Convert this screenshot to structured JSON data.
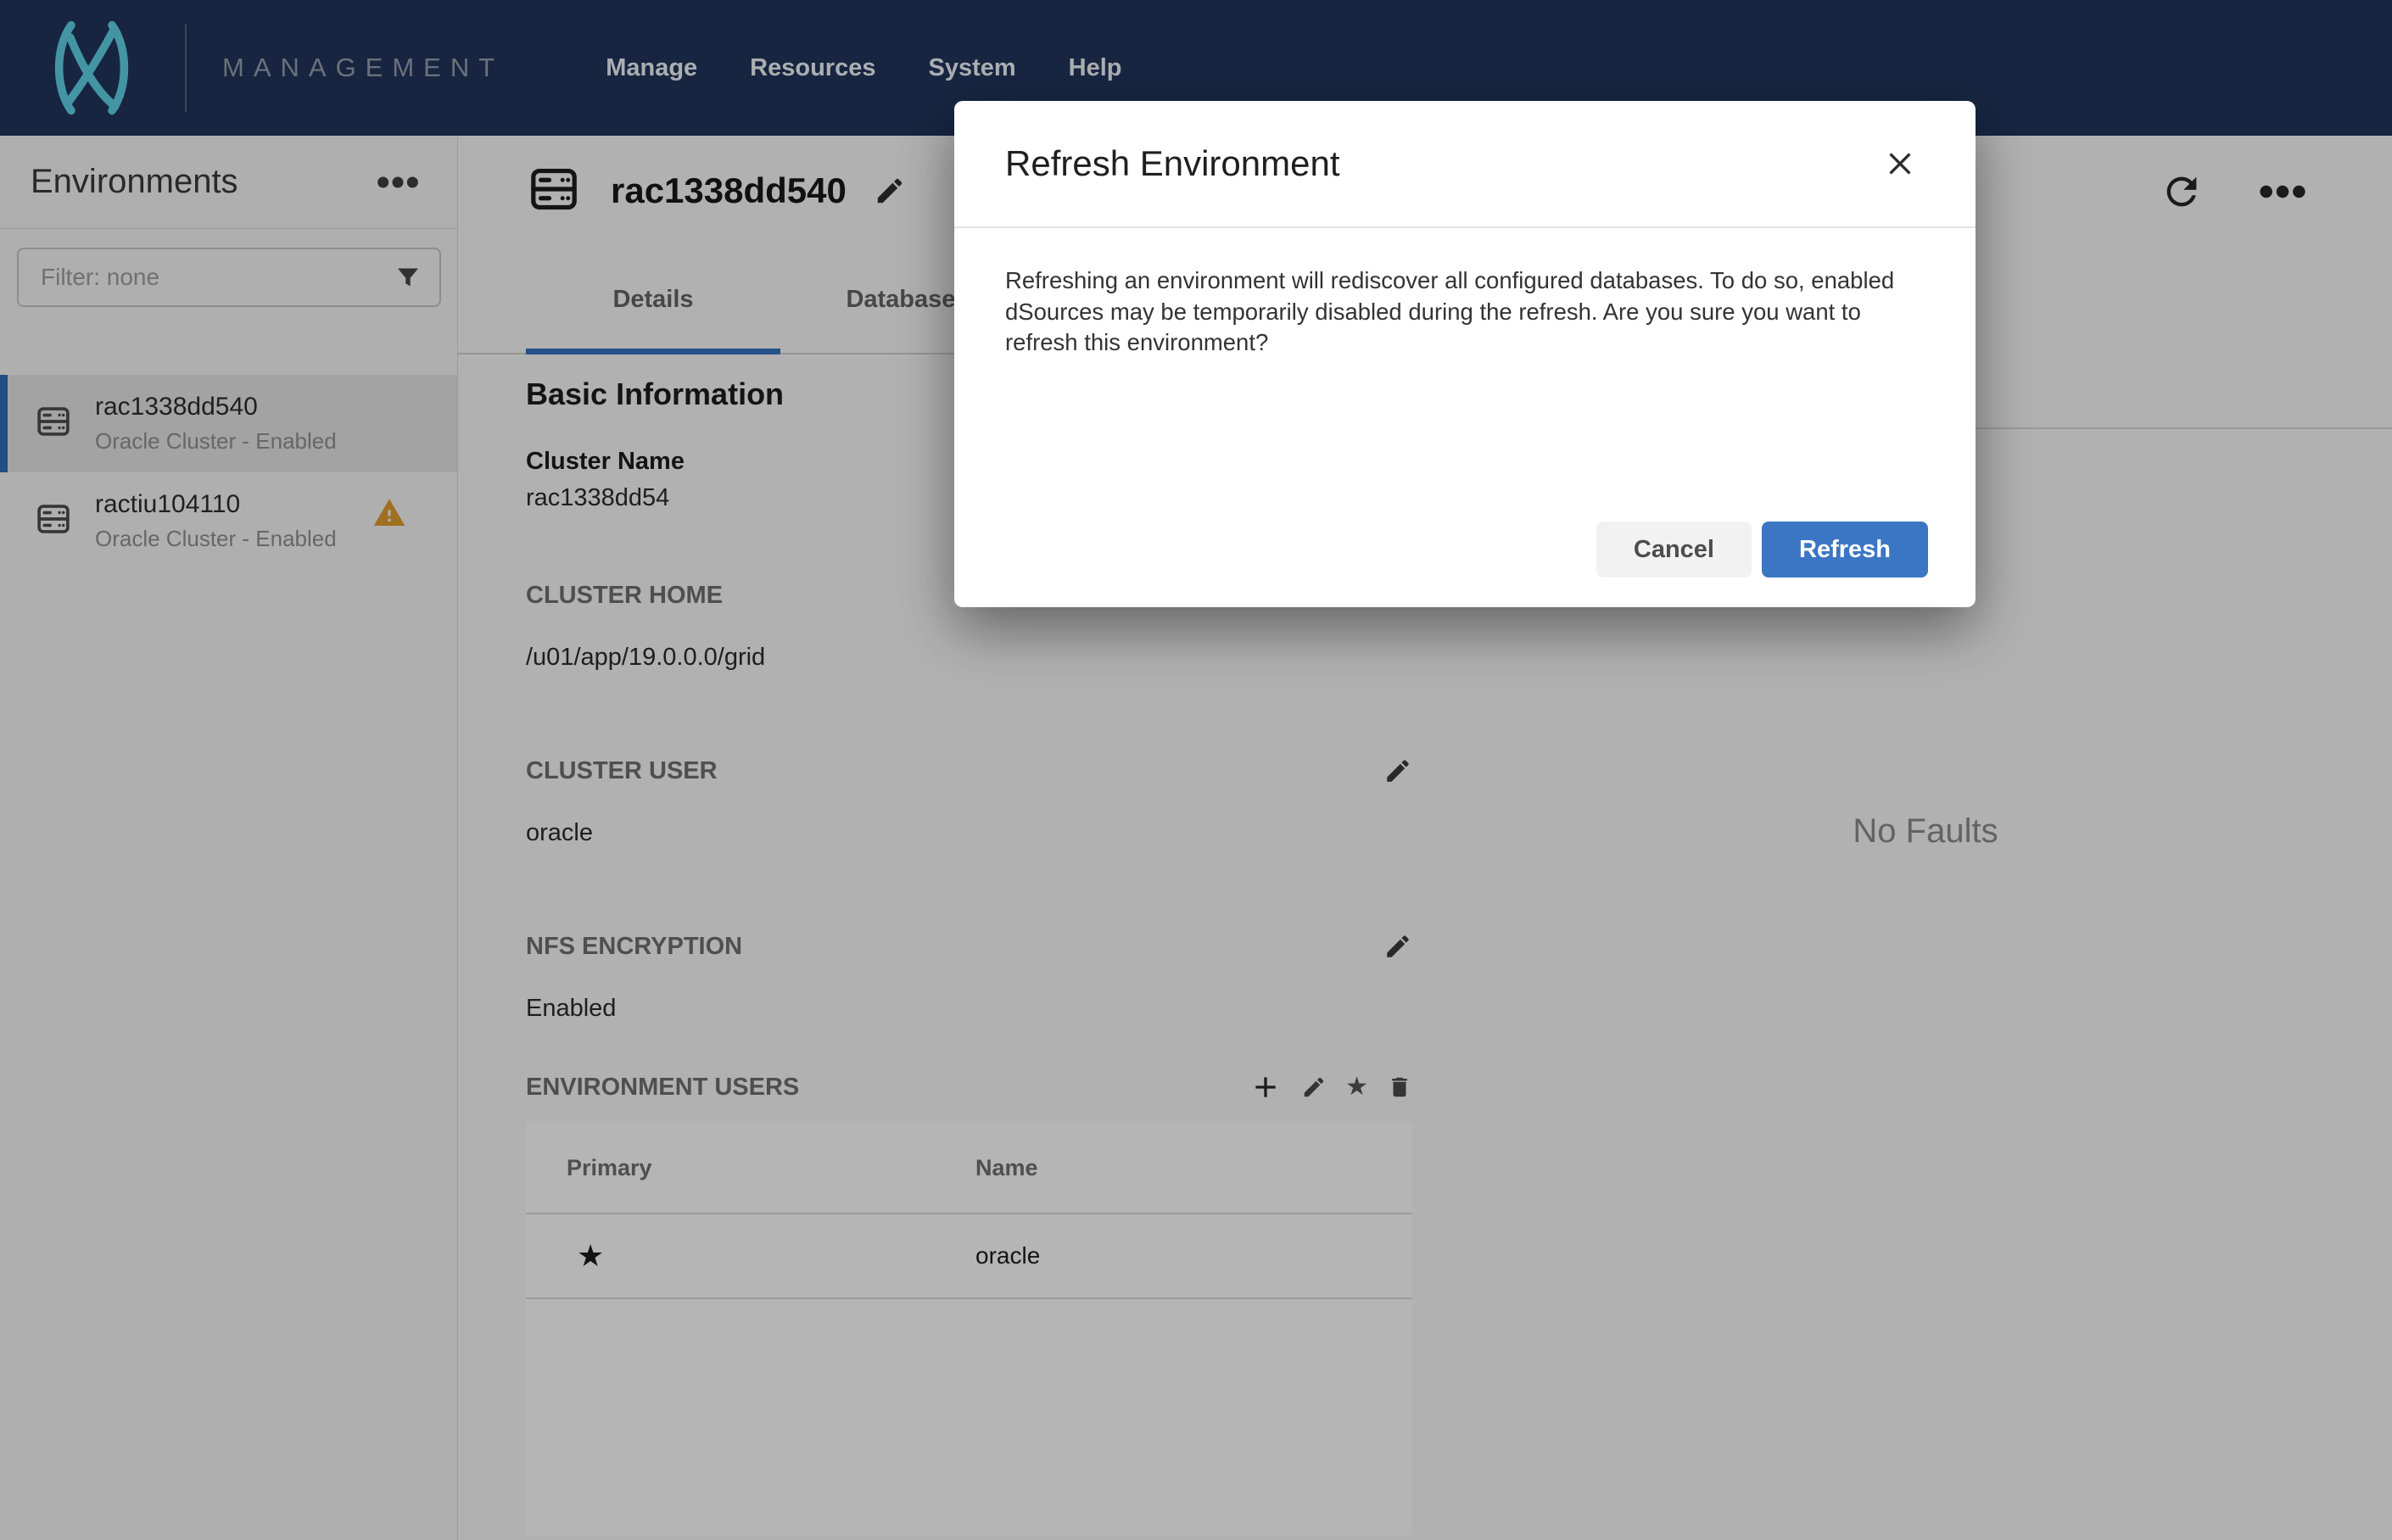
{
  "nav": {
    "brand": "MANAGEMENT",
    "items": [
      {
        "label": "Manage"
      },
      {
        "label": "Resources"
      },
      {
        "label": "System"
      },
      {
        "label": "Help"
      }
    ]
  },
  "sidebar": {
    "title": "Environments",
    "filter_placeholder": "Filter: none",
    "items": [
      {
        "name": "rac1338dd540",
        "status": "Oracle Cluster - Enabled",
        "selected": true,
        "warning": false
      },
      {
        "name": "ractiu104110",
        "status": "Oracle Cluster - Enabled",
        "selected": false,
        "warning": true
      }
    ]
  },
  "header": {
    "title": "rac1338dd540"
  },
  "tabs": [
    {
      "label": "Details",
      "active": true
    },
    {
      "label": "Databases",
      "active": false
    }
  ],
  "details": {
    "section_heading": "Basic Information",
    "cluster_name": {
      "label": "Cluster Name",
      "value": "rac1338dd54"
    },
    "cluster_home": {
      "label": "CLUSTER HOME",
      "value": "/u01/app/19.0.0.0/grid"
    },
    "cluster_user": {
      "label": "CLUSTER USER",
      "value": "oracle"
    },
    "nfs_encryption": {
      "label": "NFS ENCRYPTION",
      "value": "Enabled"
    },
    "environment_users": {
      "heading": "ENVIRONMENT USERS",
      "columns": [
        {
          "label": "Primary"
        },
        {
          "label": "Name"
        }
      ],
      "rows": [
        {
          "primary": "★",
          "name": "oracle"
        }
      ]
    }
  },
  "faults": {
    "empty_text": "No Faults"
  },
  "modal": {
    "title": "Refresh Environment",
    "message": "Refreshing an environment will rediscover all configured databases. To do so, enabled dSources may be temporarily disabled during the refresh. Are you sure you want to refresh this environment?",
    "cancel_label": "Cancel",
    "confirm_label": "Refresh"
  },
  "icons": {
    "primary_star": "★"
  },
  "colors": {
    "nav_bg": "#20345a",
    "logo_teal": "#5ecfe3",
    "accent_blue": "#3b76c4",
    "tab_underline": "#3472bd",
    "selected_bar": "#2e6cb5",
    "warning_amber": "#de9b2d"
  }
}
